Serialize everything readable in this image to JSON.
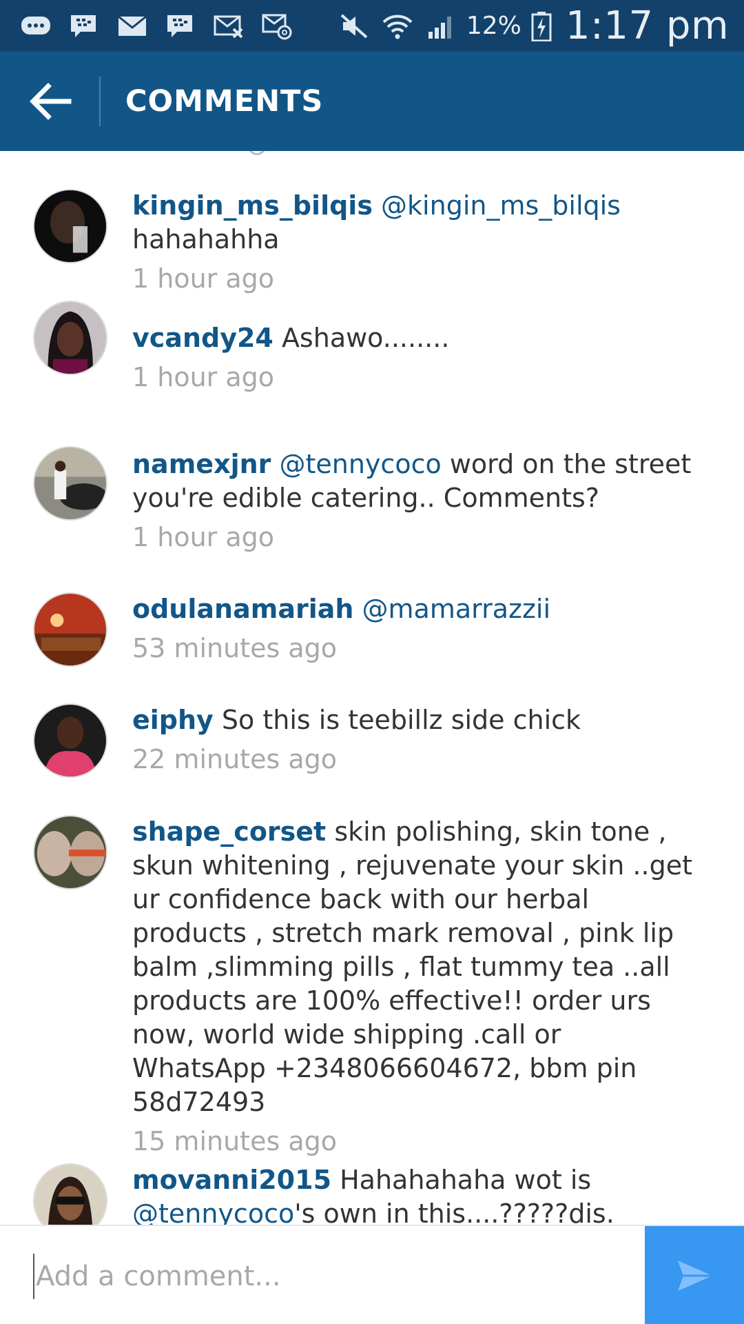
{
  "status_bar": {
    "battery_percent": "12%",
    "time": "1:17 pm",
    "icons": [
      "chat-bubble-icon",
      "bbm-icon",
      "mail-icon",
      "bbm-icon",
      "missed-mail-icon",
      "email-at-icon",
      "mute-icon",
      "wifi-icon",
      "signal-icon",
      "battery-charging-icon"
    ]
  },
  "app_bar": {
    "title": "COMMENTS",
    "color": "#125688"
  },
  "comments": [
    {
      "username": "kingin_ms_bilqis",
      "mention": "@kingin_ms_bilqis",
      "text": "hahahahha",
      "time": "1 hour ago"
    },
    {
      "username": "vcandy24",
      "mention": "",
      "text": "Ashawo........",
      "time": "1 hour ago"
    },
    {
      "username": "namexjnr",
      "mention": "@tennycoco",
      "text": "word on the street you're edible catering.. Comments?",
      "time": "1 hour ago"
    },
    {
      "username": "odulanamariah",
      "mention": "@mamarrazzii",
      "text": "",
      "time": "53 minutes ago"
    },
    {
      "username": "eiphy",
      "mention": "",
      "text": "So this is teebillz side chick",
      "time": "22 minutes ago"
    },
    {
      "username": "shape_corset",
      "mention": "",
      "text": "skin polishing, skin tone , skun whitening , rejuvenate your skin ..get ur confidence back with our herbal products , stretch mark removal , pink lip balm ,slimming pills , flat tummy tea ..all products are 100% effective!! order urs now, world wide shipping .call or WhatsApp +2348066604672, bbm pin 58d72493",
      "time": "15 minutes ago"
    },
    {
      "username": "movanni2015",
      "mention": "",
      "text": "Hahahahaha wot is",
      "mention2": "@tennycoco",
      "text2": "'s own in this....?????dis. social",
      "time": ""
    }
  ],
  "input": {
    "placeholder": "Add a comment..."
  },
  "colors": {
    "accent": "#125688",
    "send": "#3897f0",
    "timestamp": "#a8a8a8"
  }
}
